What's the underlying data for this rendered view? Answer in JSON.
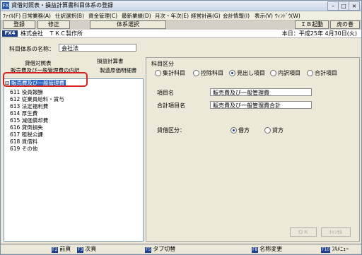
{
  "window": {
    "title": "貸借対照表・損益計算書科目体系の登録",
    "app_icon": "FX"
  },
  "menu": [
    "ﾌｧｲﾙ(F)",
    "日常業務(A)",
    "仕訳選択(B)",
    "資金管理(C)",
    "最新業績(D)",
    "月次・年次(E)",
    "経営計画(G)",
    "会計情報(I)",
    "表示(V)",
    "ｳｨﾝﾄﾞｳ(W)"
  ],
  "toolbar": {
    "register": "登録",
    "modify": "修正",
    "system_select": "体系選択",
    "ib_start": "ＩＢ起動",
    "tora": "虎の巻"
  },
  "company": {
    "badge": "FX4",
    "name": "株式会社　ＴＫＣ製作所",
    "date": "本日：平成25年 4月30日(火)"
  },
  "system_name": {
    "label": "科目体系の名称：",
    "value": "会社法"
  },
  "tabs": {
    "bs": "貸借対照表",
    "pl": "損益計算書",
    "sga": "販売費及び一般管理費の内訳",
    "mfg": "製造原価明細書"
  },
  "tree": {
    "selected": "販売費及び一般管理費",
    "items": [
      {
        "label": "611 役員報酬"
      },
      {
        "label": "612 従業員給料・賞与"
      },
      {
        "label": "613 法定福利費"
      },
      {
        "label": "614 厚生費"
      },
      {
        "label": "615 減価償却費"
      },
      {
        "label": "616 貸倒損失"
      },
      {
        "label": "617 租税公課"
      },
      {
        "label": "618 賃借料"
      },
      {
        "label": "619 その他"
      }
    ]
  },
  "classification": {
    "title": "科目区分",
    "options": [
      "集計科目",
      "控除科目",
      "見出し項目",
      "内訳項目",
      "合計項目"
    ],
    "selected": 2
  },
  "item_name": {
    "label": "項目名",
    "value": "販売費及び一般管理費"
  },
  "total_name": {
    "label": "合計項目名",
    "value": "販売費及び一般管理費合計"
  },
  "debit_credit": {
    "label": "貸借区分：",
    "options": [
      "借方",
      "貸方"
    ],
    "selected": 0
  },
  "buttons": {
    "ok": "ＯＫ",
    "cancel": "ｷｬﾝｾﾙ"
  },
  "fkeys": [
    {
      "key": "F2",
      "label": "前頁"
    },
    {
      "key": "F3",
      "label": "次頁"
    },
    {
      "key": "F5",
      "label": "タブ切替"
    },
    {
      "key": "F8",
      "label": "名称変更"
    },
    {
      "key": "F10",
      "label": "ﾌﾙﾒﾆｭｰ"
    }
  ]
}
